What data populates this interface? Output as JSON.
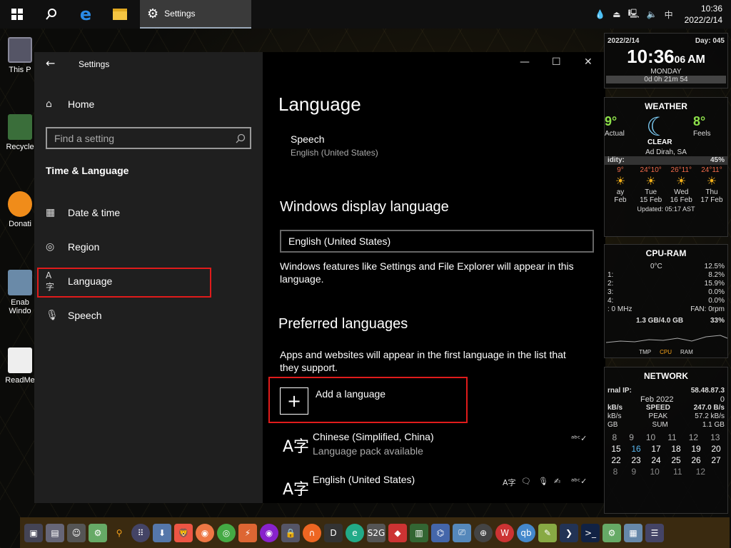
{
  "taskbar": {
    "active_app": "Settings",
    "tray_ime": "中",
    "time": "10:36",
    "date": "2022/2/14"
  },
  "desktop_icons": [
    "This P",
    "Recycle",
    "Donati",
    "Enab Windo",
    "ReadMe"
  ],
  "window": {
    "title": "Settings",
    "home": "Home",
    "search_placeholder": "Find a setting",
    "section": "Time & Language",
    "nav": [
      {
        "label": "Date & time",
        "icon": "calendar-clock-icon"
      },
      {
        "label": "Region",
        "icon": "globe-icon"
      },
      {
        "label": "Language",
        "icon": "language-icon"
      },
      {
        "label": "Speech",
        "icon": "microphone-icon"
      }
    ],
    "selected_nav": "Language",
    "highlight_color": "#e01b1b"
  },
  "content": {
    "heading": "Language",
    "speech_title": "Speech",
    "speech_value": "English (United States)",
    "display_lang_heading": "Windows display language",
    "display_lang_value": "English (United States)",
    "display_lang_desc": "Windows features like Settings and File Explorer will appear in this language.",
    "preferred_heading": "Preferred languages",
    "preferred_desc": "Apps and websites will appear in the first language in the list that they support.",
    "add_language": "Add a language",
    "languages": [
      {
        "name": "Chinese (Simplified, China)",
        "status": "Language pack available"
      },
      {
        "name": "English (United States)",
        "status": ""
      }
    ]
  },
  "gadgets": {
    "clock": {
      "date": "2022/2/14",
      "day": "Day: 045",
      "time": "10:36",
      "seconds": "06",
      "ampm": "AM",
      "weekday": "MONDAY",
      "uptime": "0d 0h 21m 54"
    },
    "weather": {
      "title": "WEATHER",
      "actual": "9°",
      "actual_label": "Actual",
      "feels": "8°",
      "feels_label": "Feels",
      "condition": "CLEAR",
      "location": "Ad Dirah, SA",
      "humidity_label": "idity:",
      "humidity": "45%",
      "forecast": [
        {
          "temps": "9°",
          "day": "ay",
          "date": "Feb"
        },
        {
          "temps": "24°10°",
          "day": "Tue",
          "date": "15 Feb"
        },
        {
          "temps": "26°11°",
          "day": "Wed",
          "date": "16 Feb"
        },
        {
          "temps": "24°11°",
          "day": "Thu",
          "date": "17 Feb"
        }
      ],
      "updated": "Updated: 05:17 AST"
    },
    "cpu": {
      "title": "CPU-RAM",
      "temp": "0°C",
      "total": "12.5%",
      "cores": [
        "8.2%",
        "15.9%",
        "0.0%",
        "0.0%"
      ],
      "clock": ": 0 MHz",
      "fan": "FAN: 0rpm",
      "ram": "1.3 GB/4.0 GB",
      "ram_pct": "33%",
      "legend": [
        "TMP",
        "CPU",
        "RAM"
      ]
    },
    "network": {
      "title": "NETWORK",
      "ip_label": "rnal IP:",
      "ip": "58.48.87.3",
      "month": "Feb 2022",
      "month_val": "0",
      "speed_label": "SPEED",
      "speed": "247.0 B/s",
      "peak_label": "PEAK",
      "peak": "57.2 kB/s",
      "sum_label": "SUM",
      "sum": "1.1 GB",
      "left1": "kB/s",
      "left2": "kB/s",
      "left3": "GB",
      "cal_rows": [
        [
          "8",
          "9",
          "10",
          "11",
          "12",
          "13"
        ],
        [
          "15",
          "16",
          "17",
          "18",
          "19",
          "20"
        ],
        [
          "22",
          "23",
          "24",
          "25",
          "26",
          "27"
        ],
        [
          "8",
          "9",
          "10",
          "11",
          "12",
          ""
        ]
      ]
    }
  }
}
